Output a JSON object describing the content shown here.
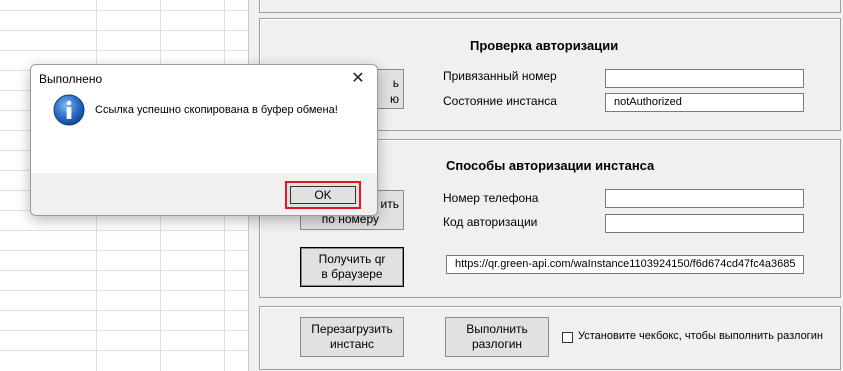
{
  "dialog": {
    "title": "Выполнено",
    "close_icon": "close-icon",
    "info_icon": "info-icon",
    "message": "Ссылка успешно скопирована в буфер обмена!",
    "ok_label": "OK"
  },
  "auth_check": {
    "heading": "Проверка авторизации",
    "linked_number_label": "Привязанный номер",
    "linked_number_value": "",
    "instance_state_label": "Состояние инстанса",
    "instance_state_value": "notAuthorized",
    "hidden_button_label_line1": "ь",
    "hidden_button_label_line2": "ю"
  },
  "auth_methods": {
    "heading": "Способы авторизации инстанса",
    "phone_label": "Номер телефона",
    "phone_value": "",
    "code_label": "Код авторизации",
    "code_value": "",
    "phone_button_line1": "ить",
    "phone_button_line2": "по номеру",
    "qr_button_line1": "Получить qr",
    "qr_button_line2": "в браузере",
    "qr_url": "https://qr.green-api.com/waInstance1103924150/f6d674cd47fc4a3685"
  },
  "actions": {
    "restart_line1": "Перезагрузить",
    "restart_line2": "инстанс",
    "logout_line1": "Выполнить",
    "logout_line2": "разлогин",
    "logout_checkbox_label": "Установите чекбокс, чтобы выполнить разлогин",
    "logout_checkbox_checked": false
  }
}
